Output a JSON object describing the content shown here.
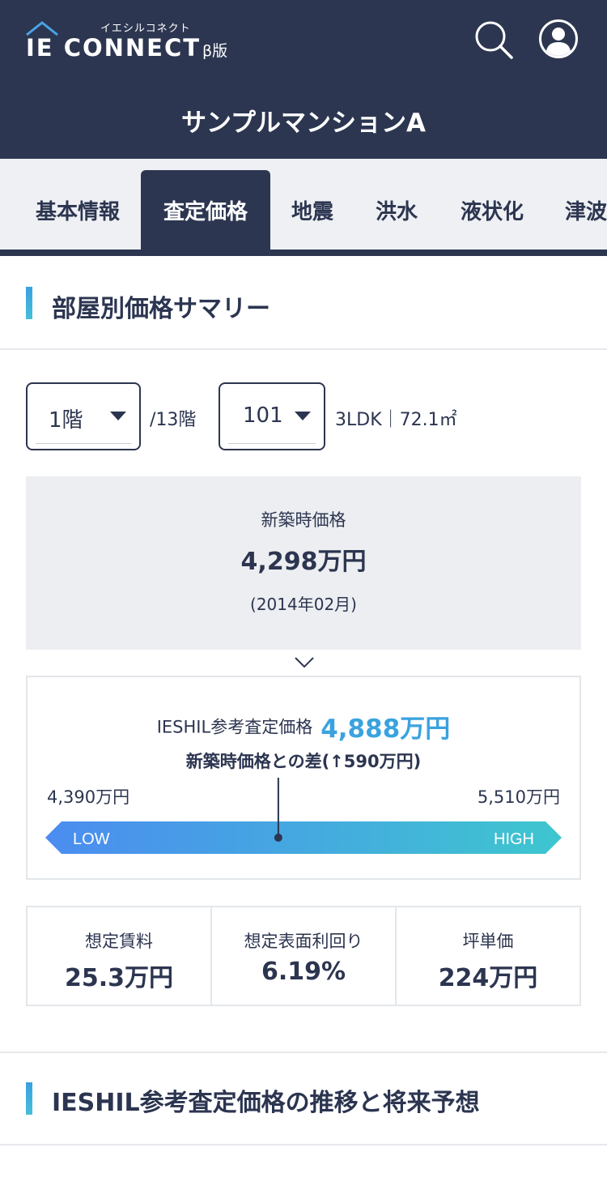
{
  "header": {
    "logo_kana": "イエシルコネクト",
    "logo_text": "IE CONNECT",
    "beta_label": "β版",
    "property_title": "サンプルマンションA"
  },
  "tabs": [
    {
      "label": "基本情報",
      "active": false
    },
    {
      "label": "査定価格",
      "active": true
    },
    {
      "label": "地震",
      "active": false
    },
    {
      "label": "洪水",
      "active": false
    },
    {
      "label": "液状化",
      "active": false
    },
    {
      "label": "津波",
      "active": false
    }
  ],
  "summary_section": {
    "title": "部屋別価格サマリー"
  },
  "selectors": {
    "floor_value": "1階",
    "floor_total": "/13階",
    "room_value": "101",
    "room_info": "3LDK｜72.1㎡"
  },
  "new_build": {
    "label": "新築時価格",
    "price": "4,298万円",
    "date": "(2014年02月)"
  },
  "estimate": {
    "label": "IESHIL参考査定価格",
    "price": "4,888万円",
    "diff": "新築時価格との差(↑590万円)",
    "range_low": "4,390万円",
    "range_high": "5,510万円",
    "low_label": "LOW",
    "high_label": "HIGH",
    "low_value": 4390,
    "high_value": 5510,
    "estimate_value": 4888,
    "gradient_start": "#4b8cf0",
    "gradient_end": "#3ec6cf"
  },
  "metrics": [
    {
      "label": "想定賃料",
      "value": "25.3万円"
    },
    {
      "label": "想定表面利回り",
      "value": "6.19%"
    },
    {
      "label": "坪単価",
      "value": "224万円"
    }
  ],
  "trend_section": {
    "title": "IESHIL参考査定価格の推移と将来予想"
  },
  "colors": {
    "navy": "#2c3650",
    "accent_blue": "#3aa3df"
  }
}
